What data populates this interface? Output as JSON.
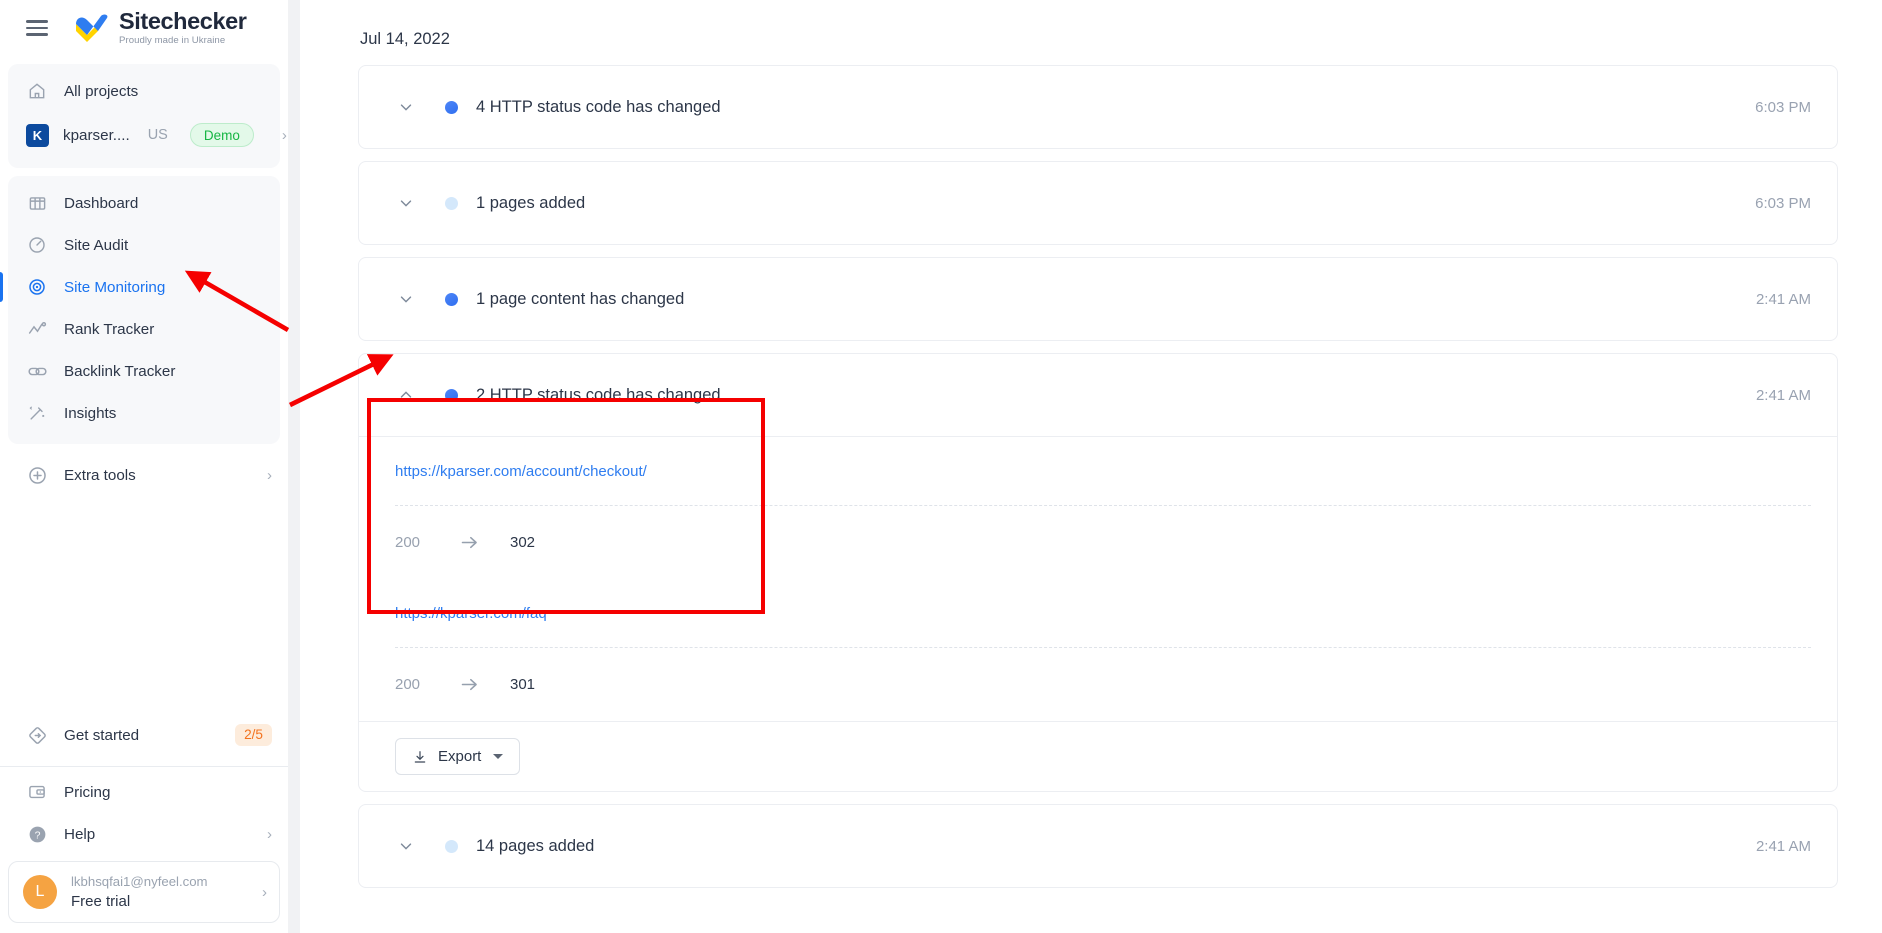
{
  "sidebar": {
    "menu_icon": "hamburger-icon",
    "logo": {
      "title": "Sitechecker",
      "subtitle": "Proudly made in Ukraine"
    },
    "top_items": [
      {
        "label": "All projects",
        "icon": "home-icon"
      }
    ],
    "project": {
      "initial": "K",
      "name": "kparser....",
      "country": "US",
      "badge": "Demo",
      "chevron": "›"
    },
    "nav_items": [
      {
        "label": "Dashboard",
        "icon": "dashboard-icon",
        "active": false
      },
      {
        "label": "Site Audit",
        "icon": "gauge-icon",
        "active": false
      },
      {
        "label": "Site Monitoring",
        "icon": "radar-icon",
        "active": true
      },
      {
        "label": "Rank Tracker",
        "icon": "chart-line-icon",
        "active": false
      },
      {
        "label": "Backlink Tracker",
        "icon": "link-icon",
        "active": false
      },
      {
        "label": "Insights",
        "icon": "magic-wand-icon",
        "active": false
      }
    ],
    "extra_tools": {
      "label": "Extra tools",
      "icon": "plus-circle-icon",
      "chevron": "›"
    },
    "get_started": {
      "label": "Get started",
      "icon": "signpost-icon",
      "badge": "2/5"
    },
    "bottom_items": [
      {
        "label": "Pricing",
        "icon": "wallet-icon",
        "chevron": ""
      },
      {
        "label": "Help",
        "icon": "question-circle-icon",
        "chevron": "›"
      }
    ],
    "user": {
      "avatar_letter": "L",
      "email": "lkbhsqfai1@nyfeel.com",
      "plan": "Free trial",
      "chevron": "›"
    }
  },
  "main": {
    "date_header": "Jul 14, 2022",
    "events": [
      {
        "title": "4 HTTP status code has changed",
        "time": "6:03 PM",
        "dot": "solid",
        "expanded": false
      },
      {
        "title": "1 pages added",
        "time": "6:03 PM",
        "dot": "light",
        "expanded": false
      },
      {
        "title": "1 page content has changed",
        "time": "2:41 AM",
        "dot": "solid",
        "expanded": false
      },
      {
        "title": "2 HTTP status code has changed",
        "time": "2:41 AM",
        "dot": "solid",
        "expanded": true
      },
      {
        "title": "14 pages added",
        "time": "2:41 AM",
        "dot": "light",
        "expanded": false
      }
    ],
    "expanded_details": [
      {
        "url": "https://kparser.com/account/checkout/",
        "old_code": "200",
        "new_code": "302"
      },
      {
        "url": "https://kparser.com/faq",
        "old_code": "200",
        "new_code": "301"
      }
    ],
    "export": {
      "label": "Export",
      "icon": "download-icon"
    }
  },
  "annotations": {
    "highlight_color": "#f50000",
    "arrows": [
      {
        "name": "arrow-to-site-monitoring"
      },
      {
        "name": "arrow-to-expanded-row"
      }
    ]
  }
}
